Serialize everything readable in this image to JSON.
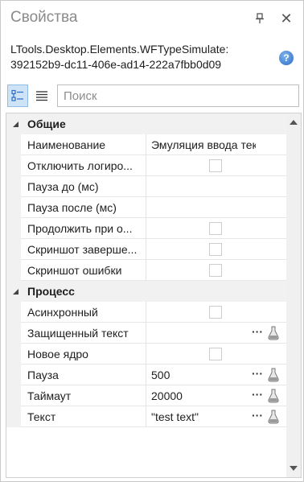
{
  "panel": {
    "title": "Свойства",
    "close_glyph": "✕"
  },
  "type_info": {
    "line1": "LTools.Desktop.Elements.WFTypeSimulate:",
    "line2": "392152b9-dc11-406e-ad14-222a7fbb0d09",
    "help_glyph": "?"
  },
  "toolbar": {
    "search_placeholder": "Поиск"
  },
  "categories": [
    {
      "label": "Общие",
      "rows": [
        {
          "name": "Наименование",
          "value": "Эмуляция ввода текста",
          "kind": "text"
        },
        {
          "name": "Отключить логиро...",
          "value": "",
          "kind": "checkbox"
        },
        {
          "name": "Пауза до (мс)",
          "value": "",
          "kind": "text"
        },
        {
          "name": "Пауза после (мс)",
          "value": "",
          "kind": "text"
        },
        {
          "name": "Продолжить при о...",
          "value": "",
          "kind": "checkbox"
        },
        {
          "name": "Скриншот заверше...",
          "value": "",
          "kind": "checkbox"
        },
        {
          "name": "Скриншот ошибки",
          "value": "",
          "kind": "checkbox"
        }
      ]
    },
    {
      "label": "Процесс",
      "rows": [
        {
          "name": "Асинхронный",
          "value": "",
          "kind": "checkbox"
        },
        {
          "name": "Защищенный текст",
          "value": "",
          "kind": "editor"
        },
        {
          "name": "Новое ядро",
          "value": "",
          "kind": "checkbox"
        },
        {
          "name": "Пауза",
          "value": "500",
          "kind": "editor"
        },
        {
          "name": "Таймаут",
          "value": "20000",
          "kind": "editor"
        },
        {
          "name": "Текст",
          "value": "\"test text\"",
          "kind": "editor"
        }
      ]
    }
  ],
  "editor_dots": "···",
  "colors": {
    "accent": "#2b6cc4",
    "category_bg": "#f1f1f1",
    "active_button_bg": "#cfe3f7"
  }
}
